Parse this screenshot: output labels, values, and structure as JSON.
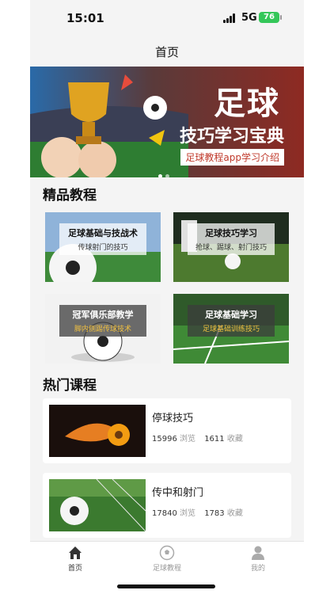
{
  "status_bar": {
    "time": "15:01",
    "network": "5G",
    "battery": "76"
  },
  "nav": {
    "title": "首页"
  },
  "banner": {
    "title_main": "足球",
    "title_sub": "技巧学习宝典",
    "subtitle": "足球教程app学习介绍",
    "slides": 2,
    "active_slide": 0
  },
  "featured": {
    "heading": "精品教程",
    "cards": [
      {
        "title": "足球基础与技战术",
        "subtitle": "传球射门的技巧"
      },
      {
        "title": "足球技巧学习",
        "subtitle": "抢球、踢球、射门技巧"
      },
      {
        "title": "冠军俱乐部教学",
        "subtitle": "脚内侧踢传球技术"
      },
      {
        "title": "足球基础学习",
        "subtitle": "足球基础训练技巧"
      }
    ]
  },
  "hot": {
    "heading": "热门课程",
    "items": [
      {
        "title": "停球技巧",
        "views": "15996",
        "views_label": "浏览",
        "favs": "1611",
        "favs_label": "收藏"
      },
      {
        "title": "传中和射门",
        "views": "17840",
        "views_label": "浏览",
        "favs": "1783",
        "favs_label": "收藏"
      }
    ]
  },
  "tabbar": {
    "items": [
      {
        "label": "首页",
        "icon": "home-icon",
        "active": true
      },
      {
        "label": "足球教程",
        "icon": "soccer-ball-icon",
        "active": false
      },
      {
        "label": "我的",
        "icon": "person-icon",
        "active": false
      }
    ]
  },
  "colors": {
    "accent": "#c0392b",
    "background": "#f4f4f4",
    "tab_active": "#333333",
    "tab_inactive": "#999999"
  }
}
